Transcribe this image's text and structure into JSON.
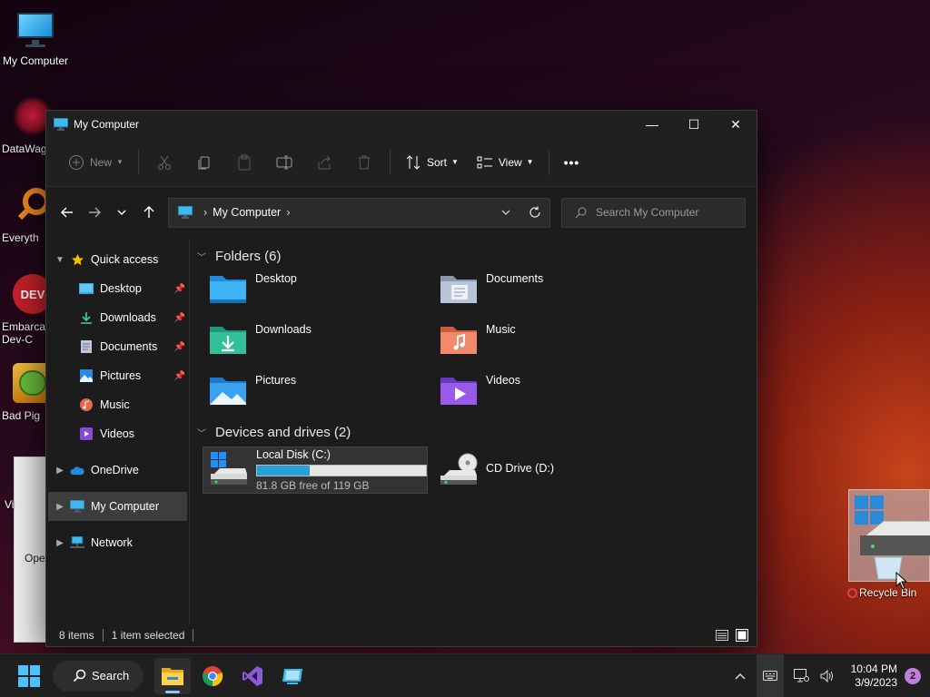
{
  "desktop": {
    "icons": [
      {
        "label": "My Computer"
      },
      {
        "label": "DataWag"
      },
      {
        "label": "Everyth"
      },
      {
        "label": "Embarca Dev-C"
      },
      {
        "label": "Bad Pig"
      },
      {
        "label": "Vi"
      },
      {
        "label": "Ope"
      }
    ],
    "drag_ghost_label": "Recycle Bin"
  },
  "window": {
    "title": "My Computer",
    "controls": {
      "minimize": "—",
      "maximize": "☐",
      "close": "✕"
    }
  },
  "toolbar": {
    "new_label": "New",
    "sort_label": "Sort",
    "view_label": "View",
    "more_label": "•••",
    "icons": [
      "cut-icon",
      "copy-icon",
      "paste-icon",
      "rename-icon",
      "share-icon",
      "delete-icon"
    ]
  },
  "address": {
    "crumb": "My Computer",
    "search_placeholder": "Search My Computer"
  },
  "navpane": {
    "quick_access": "Quick access",
    "pinned": [
      {
        "label": "Desktop",
        "pinned": true
      },
      {
        "label": "Downloads",
        "pinned": true
      },
      {
        "label": "Documents",
        "pinned": true
      },
      {
        "label": "Pictures",
        "pinned": true
      },
      {
        "label": "Music",
        "pinned": false
      },
      {
        "label": "Videos",
        "pinned": false
      }
    ],
    "onedrive": "OneDrive",
    "my_computer": "My Computer",
    "network": "Network"
  },
  "content": {
    "folders_header": "Folders (6)",
    "folders": [
      {
        "label": "Desktop"
      },
      {
        "label": "Documents"
      },
      {
        "label": "Downloads"
      },
      {
        "label": "Music"
      },
      {
        "label": "Pictures"
      },
      {
        "label": "Videos"
      }
    ],
    "devices_header": "Devices and drives (2)",
    "drives": [
      {
        "label": "Local Disk (C:)",
        "free_text": "81.8 GB free of 119 GB",
        "used_fraction": 0.31
      },
      {
        "label": "CD Drive (D:)"
      }
    ]
  },
  "status": {
    "items": "8 items",
    "selected": "1 item selected"
  },
  "taskbar": {
    "search_label": "Search",
    "time": "10:04 PM",
    "date": "3/9/2023",
    "notification_count": "2"
  },
  "colors": {
    "accent": "#26a0da",
    "window_bg": "#1c1c1c",
    "taskbar_bg": "#1f1f1f"
  }
}
